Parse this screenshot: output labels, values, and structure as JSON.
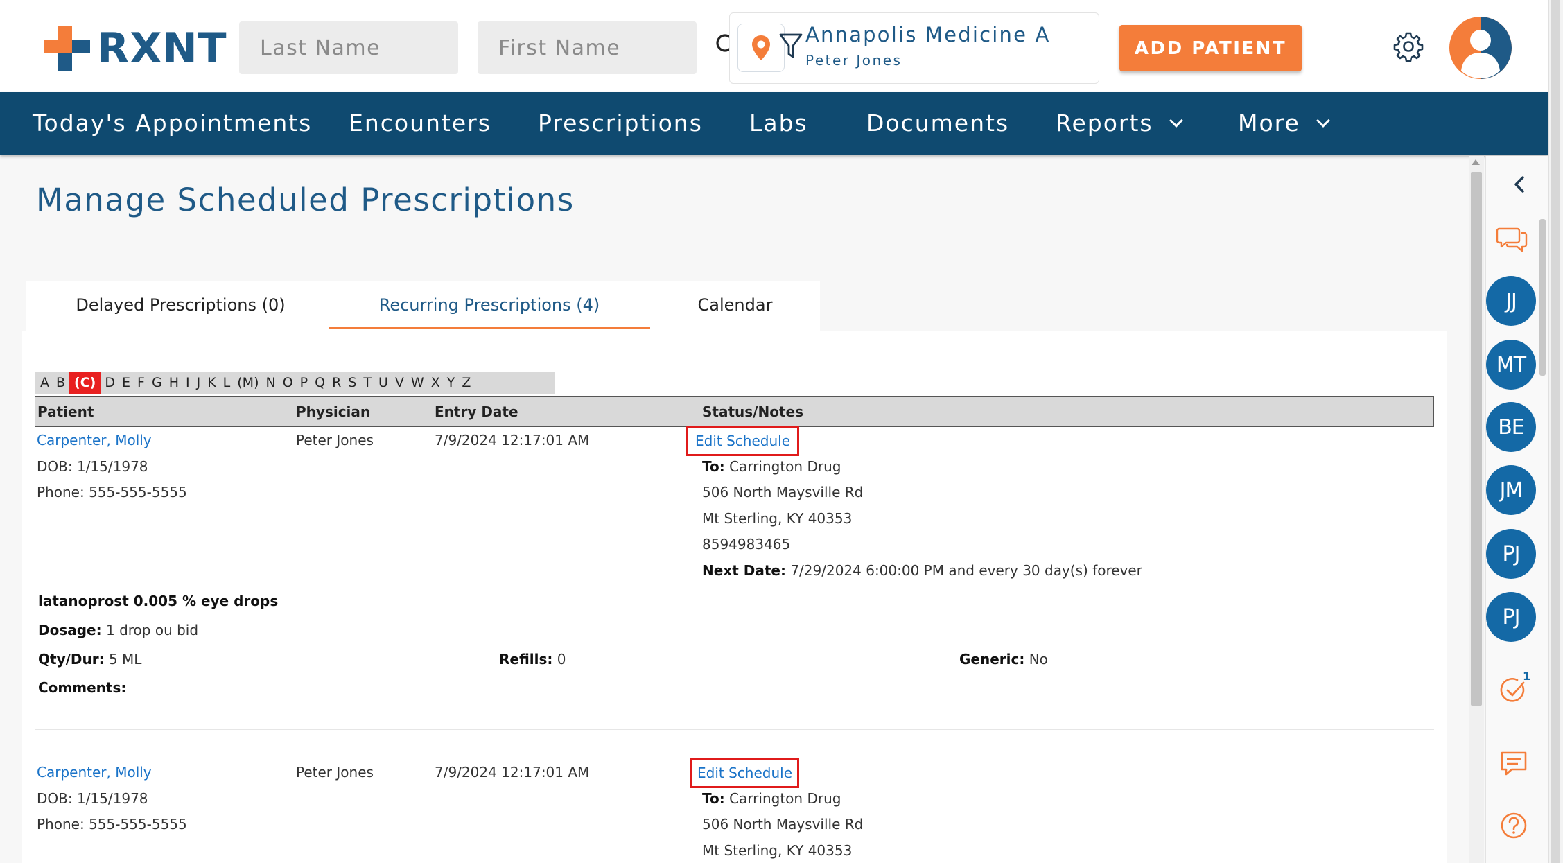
{
  "header": {
    "logo_text": "RXNT",
    "last_name_placeholder": "Last Name",
    "first_name_placeholder": "First Name",
    "location_name": "Annapolis Medicine A",
    "location_user": "Peter Jones",
    "add_patient_label": "ADD PATIENT",
    "brand_orange": "#f47d3a",
    "brand_blue": "#1f5a87"
  },
  "nav": {
    "items": [
      {
        "label": "Today's Appointments"
      },
      {
        "label": "Encounters"
      },
      {
        "label": "Prescriptions"
      },
      {
        "label": "Labs"
      },
      {
        "label": "Documents"
      },
      {
        "label": "Reports"
      },
      {
        "label": "More"
      }
    ]
  },
  "page": {
    "title": "Manage Scheduled Prescriptions"
  },
  "tabs": [
    {
      "label": "Delayed Prescriptions (0)",
      "active": false
    },
    {
      "label": "Recurring Prescriptions (4)",
      "active": true
    },
    {
      "label": "Calendar",
      "active": false
    }
  ],
  "alphabet": [
    "A",
    "B",
    "(C)",
    "D",
    "E",
    "F",
    "G",
    "H",
    "I",
    "J",
    "K",
    "L",
    "(M)",
    "N",
    "O",
    "P",
    "Q",
    "R",
    "S",
    "T",
    "U",
    "V",
    "W",
    "X",
    "Y",
    "Z"
  ],
  "alphabet_selected": "(C)",
  "table": {
    "headers": {
      "patient": "Patient",
      "physician": "Physician",
      "entry_date": "Entry Date",
      "status": "Status/Notes"
    },
    "labels": {
      "dob": "DOB:",
      "phone": "Phone:",
      "to": "To:",
      "next_date": "Next Date:",
      "dosage": "Dosage:",
      "qty": "Qty/Dur:",
      "refills": "Refills:",
      "generic": "Generic:",
      "comments": "Comments:",
      "edit_schedule": "Edit Schedule"
    },
    "rows": [
      {
        "patient": "Carpenter, Molly",
        "dob": "1/15/1978",
        "phone": "555-555-5555",
        "physician": "Peter Jones",
        "entry_date": "7/9/2024 12:17:01 AM",
        "pharmacy": "Carrington Drug",
        "address1": "506 North Maysville Rd",
        "address2": "Mt Sterling, KY 40353",
        "pharmacy_phone": "8594983465",
        "next_date": "7/29/2024 6:00:00 PM and every 30 day(s) forever",
        "medication": "latanoprost 0.005 % eye drops",
        "dosage": "1 drop ou bid",
        "qty": "5 ML",
        "refills": "0",
        "generic": "No",
        "comments": ""
      },
      {
        "patient": "Carpenter, Molly",
        "dob": "1/15/1978",
        "phone": "555-555-5555",
        "physician": "Peter Jones",
        "entry_date": "7/9/2024 12:17:01 AM",
        "pharmacy": "Carrington Drug",
        "address1": "506 North Maysville Rd",
        "address2": "Mt Sterling, KY 40353"
      }
    ]
  },
  "rail": {
    "avatars": [
      "JJ",
      "MT",
      "BE",
      "JM",
      "PJ",
      "PJ"
    ],
    "task_badge": "1"
  }
}
